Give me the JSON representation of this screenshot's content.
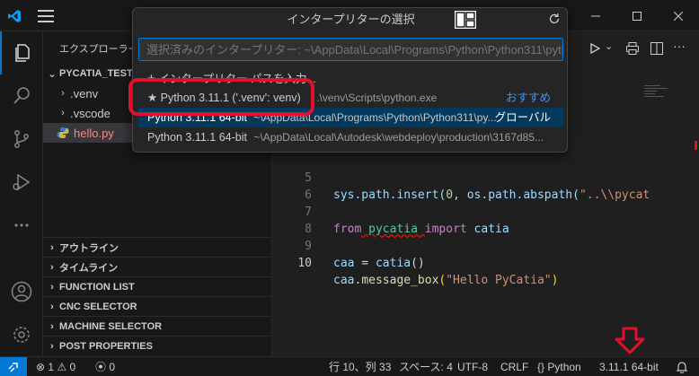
{
  "titlebar": {
    "icons": [
      "vscode-logo-icon",
      "menu-icon",
      "layout-icon",
      "refresh-icon",
      "minimize-icon",
      "maximize-icon",
      "close-icon"
    ]
  },
  "activity": [
    "explorer-icon",
    "search-icon",
    "source-control-icon",
    "run-debug-icon",
    "more-icon",
    "account-icon",
    "settings-icon"
  ],
  "sidebar": {
    "title": "エクスプローラー",
    "root": "PYCATIA_TEST",
    "items": [
      {
        "label": ".venv"
      },
      {
        "label": ".vscode"
      },
      {
        "label": "hello.py"
      }
    ],
    "sections": [
      {
        "label": "アウトライン"
      },
      {
        "label": "タイムライン"
      },
      {
        "label": "FUNCTION LIST"
      },
      {
        "label": "CNC SELECTOR"
      },
      {
        "label": "MACHINE SELECTOR"
      },
      {
        "label": "POST PROPERTIES"
      }
    ]
  },
  "quickpick": {
    "title": "インタープリターの選択",
    "placeholder": "選択済みのインタープリター: ~\\AppData\\Local\\Programs\\Python\\Python311\\python",
    "enter_path": "インタープリター パスを入力...",
    "options": [
      {
        "label": "★ Python 3.11.1 ('.venv': venv)",
        "desc": ".\\venv\\Scripts\\python.exe",
        "tag": "おすすめ"
      },
      {
        "label": "Python 3.11.1 64-bit",
        "desc": "~\\AppData\\Local\\Programs\\Python\\Python311\\py...",
        "tag": "グローバル"
      },
      {
        "label": "Python 3.11.1 64-bit",
        "desc": "~\\AppData\\Local\\Autodesk\\webdeploy\\production\\3167d85..."
      }
    ]
  },
  "code": {
    "lines": [
      {
        "n": "5",
        "t5a": "sys.path.insert(",
        "t5b": "0",
        "t5c": ", os.path.abspath(",
        "t5d": "\"..\\\\pycat"
      },
      {
        "n": "6"
      },
      {
        "n": "7",
        "kw1": "from",
        "mod": " pycatia ",
        "kw2": "import",
        "name": " catia"
      },
      {
        "n": "8"
      },
      {
        "n": "9",
        "var": "caa",
        "rest": " = ",
        "fn": "catia",
        "par": "()"
      },
      {
        "n": "10",
        "var": "caa",
        "rest": ".",
        "fn": "message_box",
        "par1": "(",
        "str": "\"Hello PyCatia\"",
        "par2": ")"
      }
    ]
  },
  "status": {
    "errors": "1",
    "warnings": "0",
    "ports": "0",
    "position": "行 10、列 33",
    "spaces": "スペース: 4",
    "encoding": "UTF-8",
    "eol": "CRLF",
    "lang_braces": "{}",
    "language": "Python",
    "interpreter": "3.11.1 64-bit"
  },
  "colors": {
    "accent": "#0078d4",
    "highlight": "#e3102d"
  }
}
